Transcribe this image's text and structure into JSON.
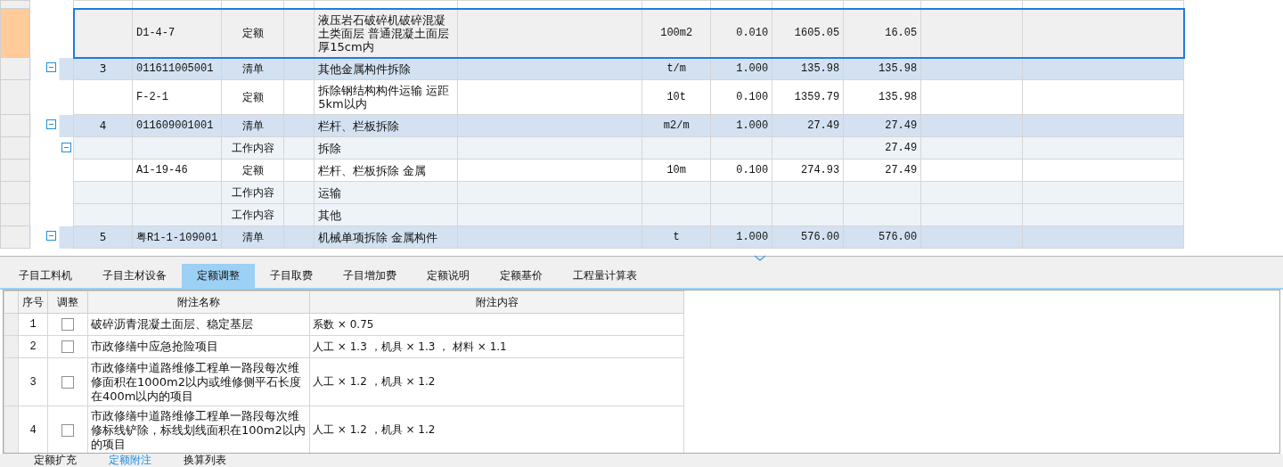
{
  "grid": {
    "rows": [
      {
        "kind": "quota",
        "selected": true,
        "code": "D1-4-7",
        "type": "定额",
        "name": "液压岩石破碎机破碎混凝土类面层 普通混凝土面层厚15cm内",
        "unit": "100m2",
        "qty": "0.010",
        "price": "1605.05",
        "total": "16.05"
      },
      {
        "kind": "list",
        "selected": false,
        "expanded": true,
        "index": "3",
        "code": "011611005001",
        "type": "清单",
        "name": "其他金属构件拆除",
        "unit": "t/m",
        "qty": "1.000",
        "price": "135.98",
        "total": "135.98"
      },
      {
        "kind": "quota",
        "selected": false,
        "code": "F-2-1",
        "type": "定额",
        "name": "拆除钢结构构件运输 运距5km以内",
        "unit": "10t",
        "qty": "0.100",
        "price": "1359.79",
        "total": "135.98"
      },
      {
        "kind": "list",
        "selected": false,
        "expanded": true,
        "index": "4",
        "code": "011609001001",
        "type": "清单",
        "name": "栏杆、栏板拆除",
        "unit": "m2/m",
        "qty": "1.000",
        "price": "27.49",
        "total": "27.49"
      },
      {
        "kind": "work",
        "selected": false,
        "expanded": true,
        "type": "工作内容",
        "name": "拆除",
        "total": "27.49"
      },
      {
        "kind": "quota",
        "selected": false,
        "code": "A1-19-46",
        "type": "定额",
        "name": "栏杆、栏板拆除 金属",
        "unit": "10m",
        "qty": "0.100",
        "price": "274.93",
        "total": "27.49"
      },
      {
        "kind": "work",
        "selected": false,
        "type": "工作内容",
        "name": "运输"
      },
      {
        "kind": "work",
        "selected": false,
        "type": "工作内容",
        "name": "其他"
      },
      {
        "kind": "list",
        "selected": false,
        "expanded": true,
        "index": "5",
        "code": "粤R1-1-109001",
        "type": "清单",
        "name": "机械单项拆除 金属构件",
        "unit": "t",
        "qty": "1.000",
        "price": "576.00",
        "total": "576.00"
      }
    ]
  },
  "tabs": [
    {
      "label": "子目工料机",
      "selected": false
    },
    {
      "label": "子目主材设备",
      "selected": false
    },
    {
      "label": "定额调整",
      "selected": true
    },
    {
      "label": "子目取费",
      "selected": false
    },
    {
      "label": "子目增加费",
      "selected": false
    },
    {
      "label": "定额说明",
      "selected": false
    },
    {
      "label": "定额基价",
      "selected": false
    },
    {
      "label": "工程量计算表",
      "selected": false
    }
  ],
  "notes": {
    "columns": [
      "序号",
      "调整",
      "附注名称",
      "附注内容"
    ],
    "rows": [
      {
        "index": "1",
        "checked": false,
        "name": "破碎沥青混凝土面层、稳定基层",
        "content": "系数 × 0.75"
      },
      {
        "index": "2",
        "checked": false,
        "name": "市政修缮中应急抢险项目",
        "content": "人工 × 1.3 ，机具 × 1.3 ， 材料 × 1.1"
      },
      {
        "index": "3",
        "checked": false,
        "name": "市政修缮中道路维修工程单一路段每次维修面积在1000m2以内或维修侧平石长度在400m以内的项目",
        "content": "人工 × 1.2 ，机具 × 1.2"
      },
      {
        "index": "4",
        "checked": false,
        "name": "市政修缮中道路维修工程单一路段每次维修标线铲除，标线划线面积在100m2以内的项目",
        "content": "人工 × 1.2 ，机具 × 1.2"
      }
    ]
  },
  "bottom_tabs": [
    {
      "label": "定额扩充",
      "selected": false
    },
    {
      "label": "定额附注",
      "selected": true
    },
    {
      "label": "换算列表",
      "selected": false
    }
  ]
}
